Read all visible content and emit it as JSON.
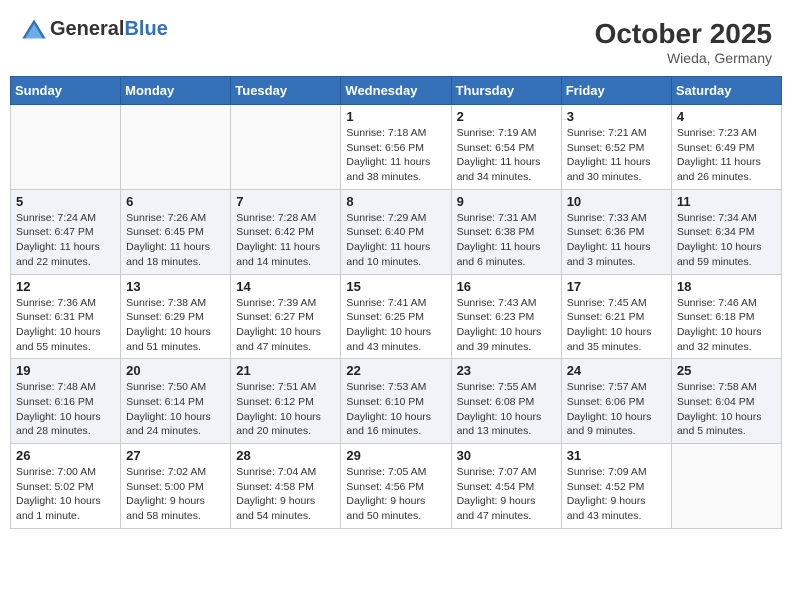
{
  "header": {
    "logo_general": "General",
    "logo_blue": "Blue",
    "month_title": "October 2025",
    "location": "Wieda, Germany"
  },
  "days_of_week": [
    "Sunday",
    "Monday",
    "Tuesday",
    "Wednesday",
    "Thursday",
    "Friday",
    "Saturday"
  ],
  "weeks": [
    {
      "days": [
        {
          "num": "",
          "info": ""
        },
        {
          "num": "",
          "info": ""
        },
        {
          "num": "",
          "info": ""
        },
        {
          "num": "1",
          "info": "Sunrise: 7:18 AM\nSunset: 6:56 PM\nDaylight: 11 hours\nand 38 minutes."
        },
        {
          "num": "2",
          "info": "Sunrise: 7:19 AM\nSunset: 6:54 PM\nDaylight: 11 hours\nand 34 minutes."
        },
        {
          "num": "3",
          "info": "Sunrise: 7:21 AM\nSunset: 6:52 PM\nDaylight: 11 hours\nand 30 minutes."
        },
        {
          "num": "4",
          "info": "Sunrise: 7:23 AM\nSunset: 6:49 PM\nDaylight: 11 hours\nand 26 minutes."
        }
      ]
    },
    {
      "days": [
        {
          "num": "5",
          "info": "Sunrise: 7:24 AM\nSunset: 6:47 PM\nDaylight: 11 hours\nand 22 minutes."
        },
        {
          "num": "6",
          "info": "Sunrise: 7:26 AM\nSunset: 6:45 PM\nDaylight: 11 hours\nand 18 minutes."
        },
        {
          "num": "7",
          "info": "Sunrise: 7:28 AM\nSunset: 6:42 PM\nDaylight: 11 hours\nand 14 minutes."
        },
        {
          "num": "8",
          "info": "Sunrise: 7:29 AM\nSunset: 6:40 PM\nDaylight: 11 hours\nand 10 minutes."
        },
        {
          "num": "9",
          "info": "Sunrise: 7:31 AM\nSunset: 6:38 PM\nDaylight: 11 hours\nand 6 minutes."
        },
        {
          "num": "10",
          "info": "Sunrise: 7:33 AM\nSunset: 6:36 PM\nDaylight: 11 hours\nand 3 minutes."
        },
        {
          "num": "11",
          "info": "Sunrise: 7:34 AM\nSunset: 6:34 PM\nDaylight: 10 hours\nand 59 minutes."
        }
      ]
    },
    {
      "days": [
        {
          "num": "12",
          "info": "Sunrise: 7:36 AM\nSunset: 6:31 PM\nDaylight: 10 hours\nand 55 minutes."
        },
        {
          "num": "13",
          "info": "Sunrise: 7:38 AM\nSunset: 6:29 PM\nDaylight: 10 hours\nand 51 minutes."
        },
        {
          "num": "14",
          "info": "Sunrise: 7:39 AM\nSunset: 6:27 PM\nDaylight: 10 hours\nand 47 minutes."
        },
        {
          "num": "15",
          "info": "Sunrise: 7:41 AM\nSunset: 6:25 PM\nDaylight: 10 hours\nand 43 minutes."
        },
        {
          "num": "16",
          "info": "Sunrise: 7:43 AM\nSunset: 6:23 PM\nDaylight: 10 hours\nand 39 minutes."
        },
        {
          "num": "17",
          "info": "Sunrise: 7:45 AM\nSunset: 6:21 PM\nDaylight: 10 hours\nand 35 minutes."
        },
        {
          "num": "18",
          "info": "Sunrise: 7:46 AM\nSunset: 6:18 PM\nDaylight: 10 hours\nand 32 minutes."
        }
      ]
    },
    {
      "days": [
        {
          "num": "19",
          "info": "Sunrise: 7:48 AM\nSunset: 6:16 PM\nDaylight: 10 hours\nand 28 minutes."
        },
        {
          "num": "20",
          "info": "Sunrise: 7:50 AM\nSunset: 6:14 PM\nDaylight: 10 hours\nand 24 minutes."
        },
        {
          "num": "21",
          "info": "Sunrise: 7:51 AM\nSunset: 6:12 PM\nDaylight: 10 hours\nand 20 minutes."
        },
        {
          "num": "22",
          "info": "Sunrise: 7:53 AM\nSunset: 6:10 PM\nDaylight: 10 hours\nand 16 minutes."
        },
        {
          "num": "23",
          "info": "Sunrise: 7:55 AM\nSunset: 6:08 PM\nDaylight: 10 hours\nand 13 minutes."
        },
        {
          "num": "24",
          "info": "Sunrise: 7:57 AM\nSunset: 6:06 PM\nDaylight: 10 hours\nand 9 minutes."
        },
        {
          "num": "25",
          "info": "Sunrise: 7:58 AM\nSunset: 6:04 PM\nDaylight: 10 hours\nand 5 minutes."
        }
      ]
    },
    {
      "days": [
        {
          "num": "26",
          "info": "Sunrise: 7:00 AM\nSunset: 5:02 PM\nDaylight: 10 hours\nand 1 minute."
        },
        {
          "num": "27",
          "info": "Sunrise: 7:02 AM\nSunset: 5:00 PM\nDaylight: 9 hours\nand 58 minutes."
        },
        {
          "num": "28",
          "info": "Sunrise: 7:04 AM\nSunset: 4:58 PM\nDaylight: 9 hours\nand 54 minutes."
        },
        {
          "num": "29",
          "info": "Sunrise: 7:05 AM\nSunset: 4:56 PM\nDaylight: 9 hours\nand 50 minutes."
        },
        {
          "num": "30",
          "info": "Sunrise: 7:07 AM\nSunset: 4:54 PM\nDaylight: 9 hours\nand 47 minutes."
        },
        {
          "num": "31",
          "info": "Sunrise: 7:09 AM\nSunset: 4:52 PM\nDaylight: 9 hours\nand 43 minutes."
        },
        {
          "num": "",
          "info": ""
        }
      ]
    }
  ]
}
